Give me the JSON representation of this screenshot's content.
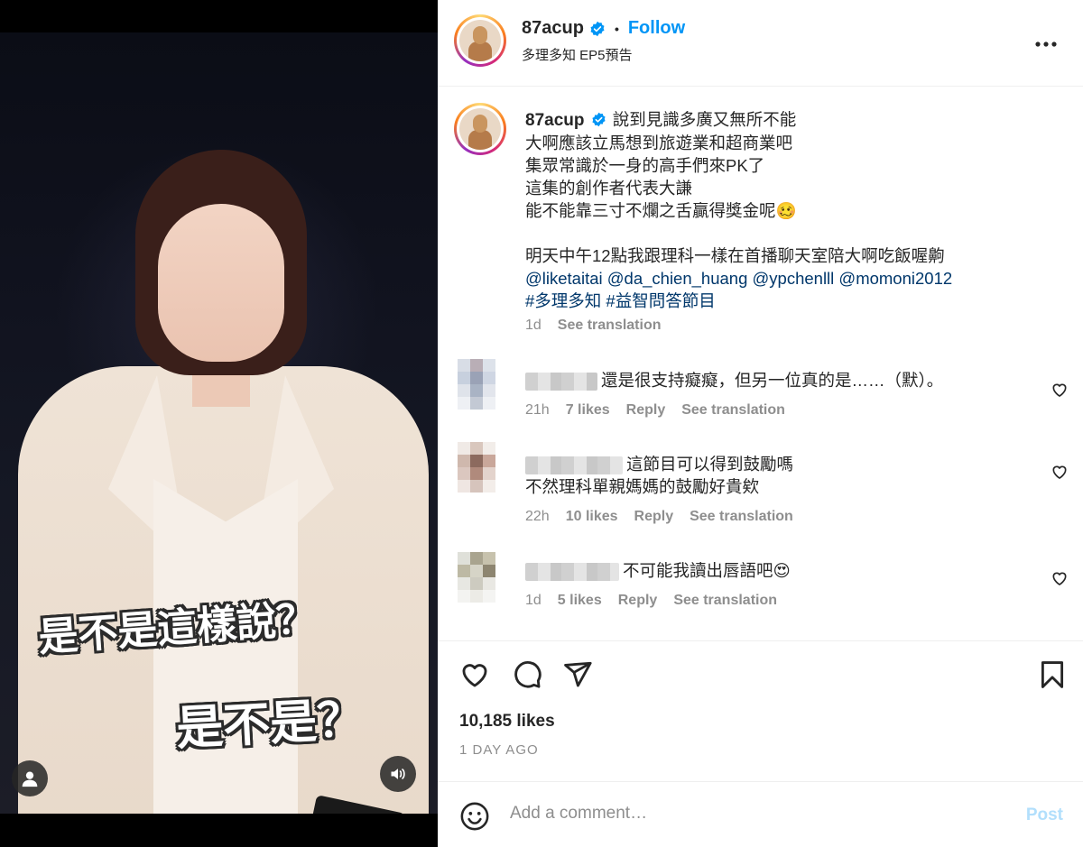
{
  "media": {
    "caption_1": "是不是這樣說？",
    "caption_2": "是不是？"
  },
  "header": {
    "username": "87acup",
    "follow_label": "Follow",
    "subtitle": "多理多知 EP5預告",
    "dot": "•"
  },
  "post": {
    "username": "87acup",
    "lines": [
      "說到見識多廣又無所不能",
      "大啊應該立馬想到旅遊業和超商業吧",
      "集眾常識於一身的高手們來PK了",
      "這集的創作者代表大謙",
      "能不能靠三寸不爛之舌贏得獎金呢🥴",
      "",
      "明天中午12點我跟理科一樣在首播聊天室陪大啊吃飯喔齁"
    ],
    "mentions": "@liketaitai @da_chien_huang @ypchenlll @momoni2012",
    "hashtags": "#多理多知 #益智問答節目",
    "time": "1d",
    "see_translation": "See translation"
  },
  "comments": [
    {
      "lines": [
        "還是很支持癡癡，但另一位真的是……（默）。"
      ],
      "time": "21h",
      "likes": "7 likes",
      "reply": "Reply",
      "see_translation": "See translation"
    },
    {
      "lines": [
        "這節目可以得到鼓勵嗎",
        "不然理科單親媽媽的鼓勵好貴欸"
      ],
      "time": "22h",
      "likes": "10 likes",
      "reply": "Reply",
      "see_translation": "See translation"
    },
    {
      "lines": [
        "不可能我讀出唇語吧😍"
      ],
      "time": "1d",
      "likes": "5 likes",
      "reply": "Reply",
      "see_translation": "See translation"
    }
  ],
  "actions": {
    "likes": "10,185 likes",
    "ago": "1 DAY AGO"
  },
  "add_comment": {
    "placeholder": "Add a comment…",
    "post_label": "Post"
  },
  "colors": {
    "accent": "#0095f6",
    "link": "#00376b",
    "muted": "#8e8e8e",
    "post_disabled": "#b2dffc"
  }
}
